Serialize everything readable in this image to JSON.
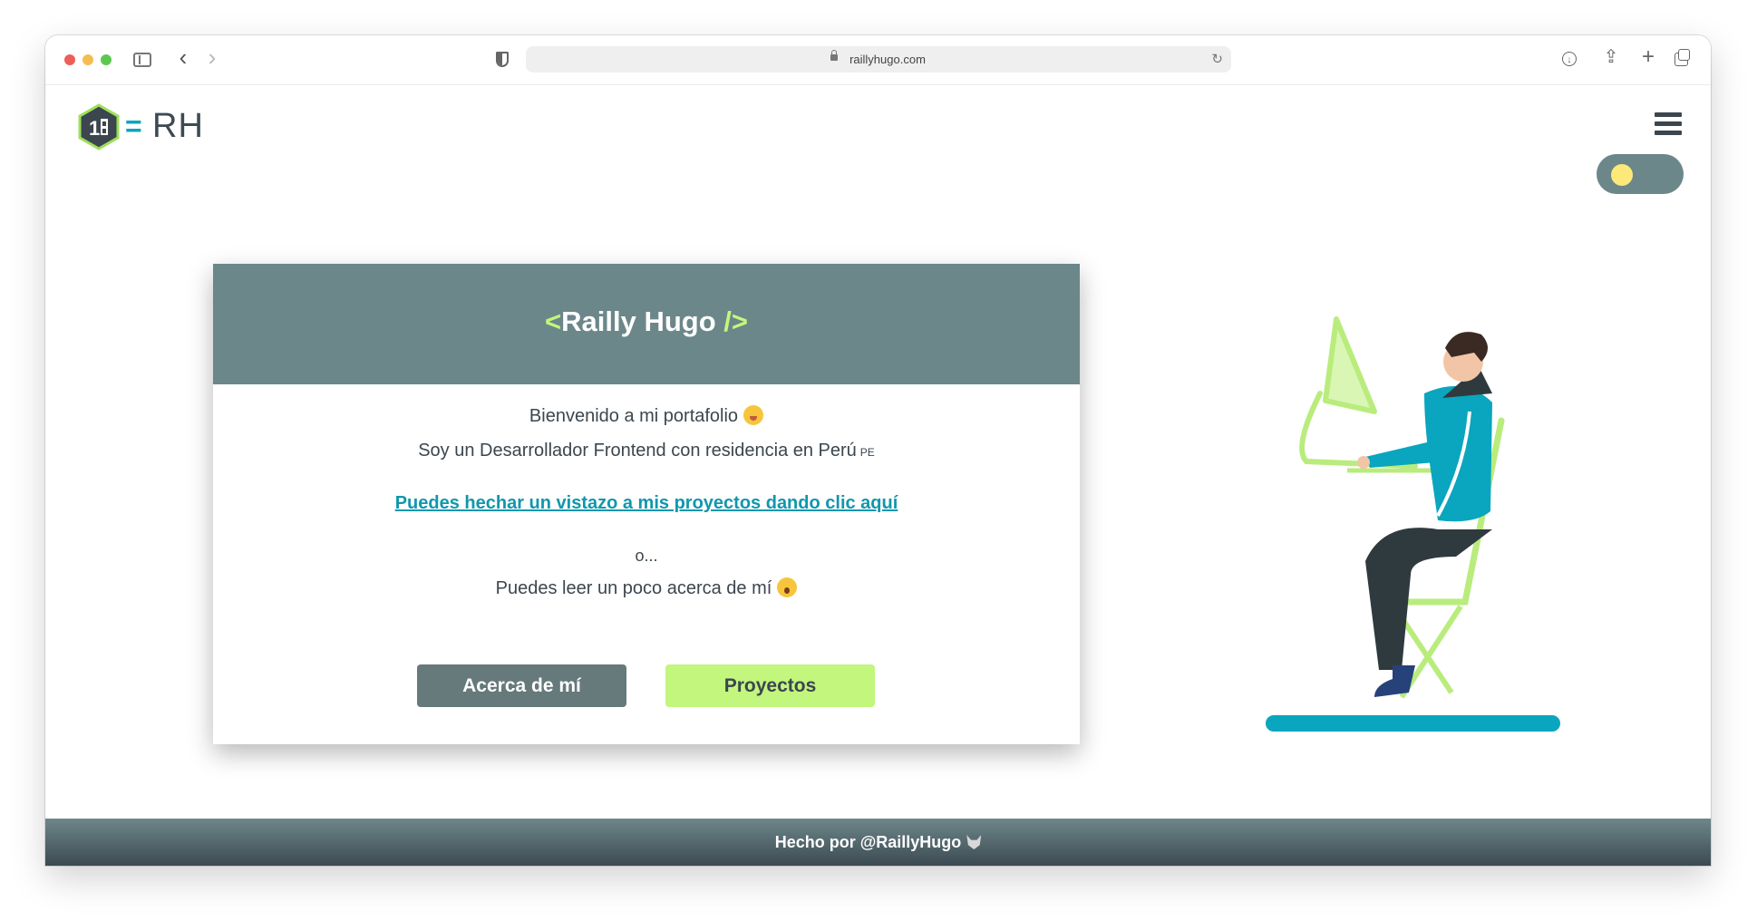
{
  "browser": {
    "url": "raillyhugo.com"
  },
  "header": {
    "logo_text": "RH",
    "logo_eq": "=",
    "icons": [
      "logo-hex-icon",
      "menu-icon",
      "theme-toggle"
    ]
  },
  "card": {
    "title_open": "<",
    "title_name": "Railly Hugo",
    "title_close": "/>",
    "welcome": "Bienvenido a mi portafolio",
    "intro": "Soy un Desarrollador Frontend con residencia en Perú",
    "flag": "PE",
    "projects_link": "Puedes hechar un vistazo a mis proyectos dando clic aquí",
    "or_text": "o...",
    "about_text": "Puedes leer un poco acerca de mí",
    "about_button": "Acerca de mí",
    "projects_button": "Proyectos"
  },
  "footer": {
    "text": "Hecho por @RaillyHugo"
  },
  "colors": {
    "header_bg": "#6b878a",
    "accent_green": "#c2f67d",
    "accent_teal": "#0aa5be",
    "dark": "#3b464e"
  }
}
